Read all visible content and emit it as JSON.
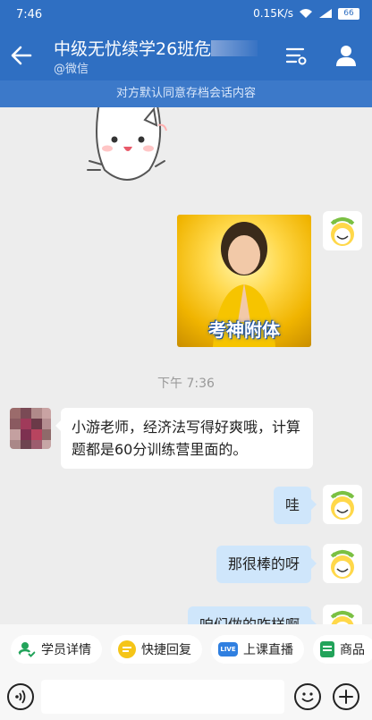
{
  "status": {
    "time": "7:46",
    "speed": "0.15K/s",
    "battery": "66"
  },
  "header": {
    "title": "中级无忧续学26班危",
    "subtitle": "@微信"
  },
  "notice": "对方默认同意存档会话内容",
  "messages": {
    "photo_caption": "考神附体",
    "timestamp": "下午 7:36",
    "other_text": "小游老师，经济法写得好爽哦，计算题都是60分训练营里面的。",
    "me_1": "哇",
    "me_2": "那很棒的呀",
    "me_3": "咱们做的咋样啊"
  },
  "quickbar": {
    "student_info": "学员详情",
    "quick_reply": "快捷回复",
    "live_class": "上课直播",
    "products": "商品",
    "live_badge": "LIVE"
  },
  "colors": {
    "brand": "#2f6fc2",
    "my_bubble": "#cfe6fb"
  }
}
